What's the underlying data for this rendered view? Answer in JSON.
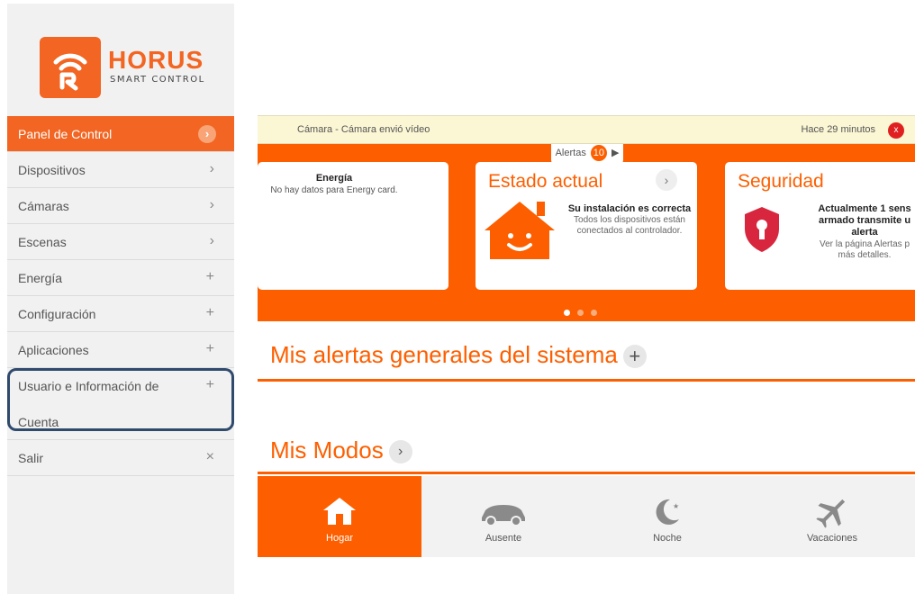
{
  "app": {
    "brand": "HORUS",
    "brand_sub": "SMART CONTROL",
    "accent": "#fd5f00"
  },
  "sidebar": {
    "items": [
      {
        "label": "Panel de Control",
        "symbol": "›"
      },
      {
        "label": "Dispositivos",
        "symbol": "›"
      },
      {
        "label": "Cámaras",
        "symbol": "›"
      },
      {
        "label": "Escenas",
        "symbol": "›"
      },
      {
        "label": "Energía",
        "symbol": "+"
      },
      {
        "label": "Configuración",
        "symbol": "+"
      },
      {
        "label": "Aplicaciones",
        "symbol": "+"
      },
      {
        "label": "Usuario e Información de",
        "label2": "Cuenta",
        "symbol": "+"
      },
      {
        "label": "Salir",
        "symbol": "×"
      }
    ]
  },
  "notification": {
    "message": "Cámara - Cámara envió vídeo",
    "time": "Hace 29 minutos",
    "close": "x"
  },
  "alerts_tab": {
    "label": "Alertas",
    "count": "10",
    "arrow": "▶"
  },
  "cards": {
    "energy": {
      "title": "Energía",
      "text": "No hay datos para Energy card."
    },
    "status": {
      "title": "Estado actual",
      "headline": "Su instalación es correcta",
      "line1": "Todos los dispositivos están",
      "line2": "conectados al controlador."
    },
    "security": {
      "title": "Seguridad",
      "line1": "Actualmente 1 sens",
      "line2": "armado transmite u",
      "line3": "alerta",
      "line4": "Ver la página Alertas p",
      "line5": "más detalles."
    }
  },
  "sections": {
    "alerts_title": "Mis alertas generales del sistema",
    "alerts_action": "+",
    "modes_title": "Mis Modos",
    "modes_action": "›"
  },
  "modes": [
    {
      "label": "Hogar",
      "icon": "house-icon",
      "active": true
    },
    {
      "label": "Ausente",
      "icon": "car-icon",
      "active": false
    },
    {
      "label": "Noche",
      "icon": "moon-icon",
      "active": false
    },
    {
      "label": "Vacaciones",
      "icon": "plane-icon",
      "active": false
    }
  ]
}
